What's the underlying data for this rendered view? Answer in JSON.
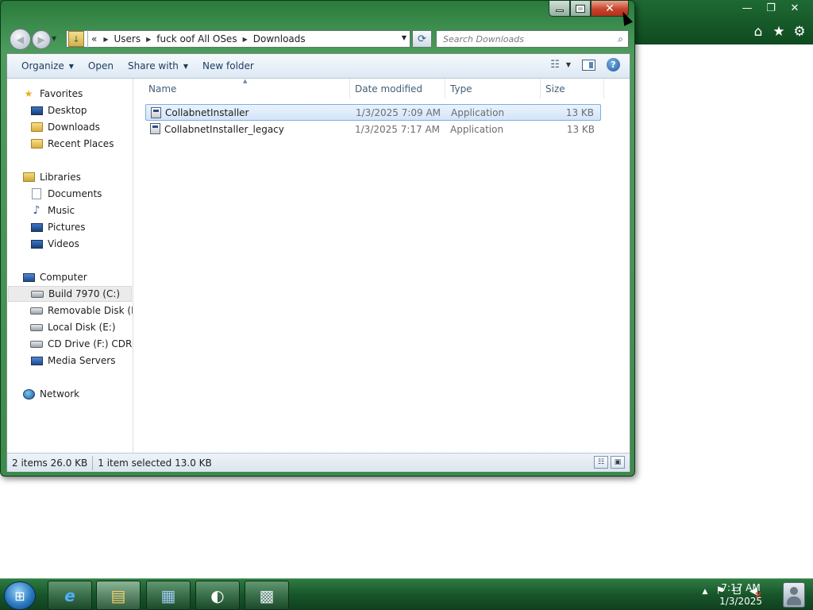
{
  "background_window": {
    "caption_buttons": {
      "minimize": "—",
      "restore": "❐",
      "close": "✕"
    },
    "toolbar_icons": {
      "home": "⌂",
      "favorites": "★",
      "tools": "⚙"
    }
  },
  "explorer": {
    "caption_buttons": {
      "close": "✕"
    },
    "address": {
      "overflow": "«",
      "crumbs": [
        "Users",
        "fuck oof All OSes",
        "Downloads"
      ]
    },
    "search": {
      "placeholder": "Search Downloads"
    },
    "toolbar": {
      "organize": "Organize",
      "open": "Open",
      "share_with": "Share with",
      "new_folder": "New folder"
    },
    "navigation": {
      "favorites": "Favorites",
      "desktop": "Desktop",
      "downloads": "Downloads",
      "recent_places": "Recent Places",
      "libraries": "Libraries",
      "documents": "Documents",
      "music": "Music",
      "pictures": "Pictures",
      "videos": "Videos",
      "computer": "Computer",
      "drive_c": "Build 7970 (C:)",
      "drive_d": "Removable Disk (D:)",
      "drive_e": "Local Disk (E:)",
      "drive_f": "CD Drive (F:) CDROM",
      "media_servers": "Media Servers",
      "network": "Network"
    },
    "columns": {
      "name": "Name",
      "date": "Date modified",
      "type": "Type",
      "size": "Size"
    },
    "files": [
      {
        "name": "CollabnetInstaller",
        "date": "1/3/2025 7:09 AM",
        "type": "Application",
        "size": "13 KB",
        "selected": true
      },
      {
        "name": "CollabnetInstaller_legacy",
        "date": "1/3/2025 7:17 AM",
        "type": "Application",
        "size": "13 KB",
        "selected": false
      }
    ],
    "status": {
      "items": "2 items  26.0 KB",
      "selection": "1 item selected  13.0 KB"
    }
  },
  "taskbar": {
    "clock_time": "7:17 AM",
    "clock_date": "1/3/2025"
  }
}
